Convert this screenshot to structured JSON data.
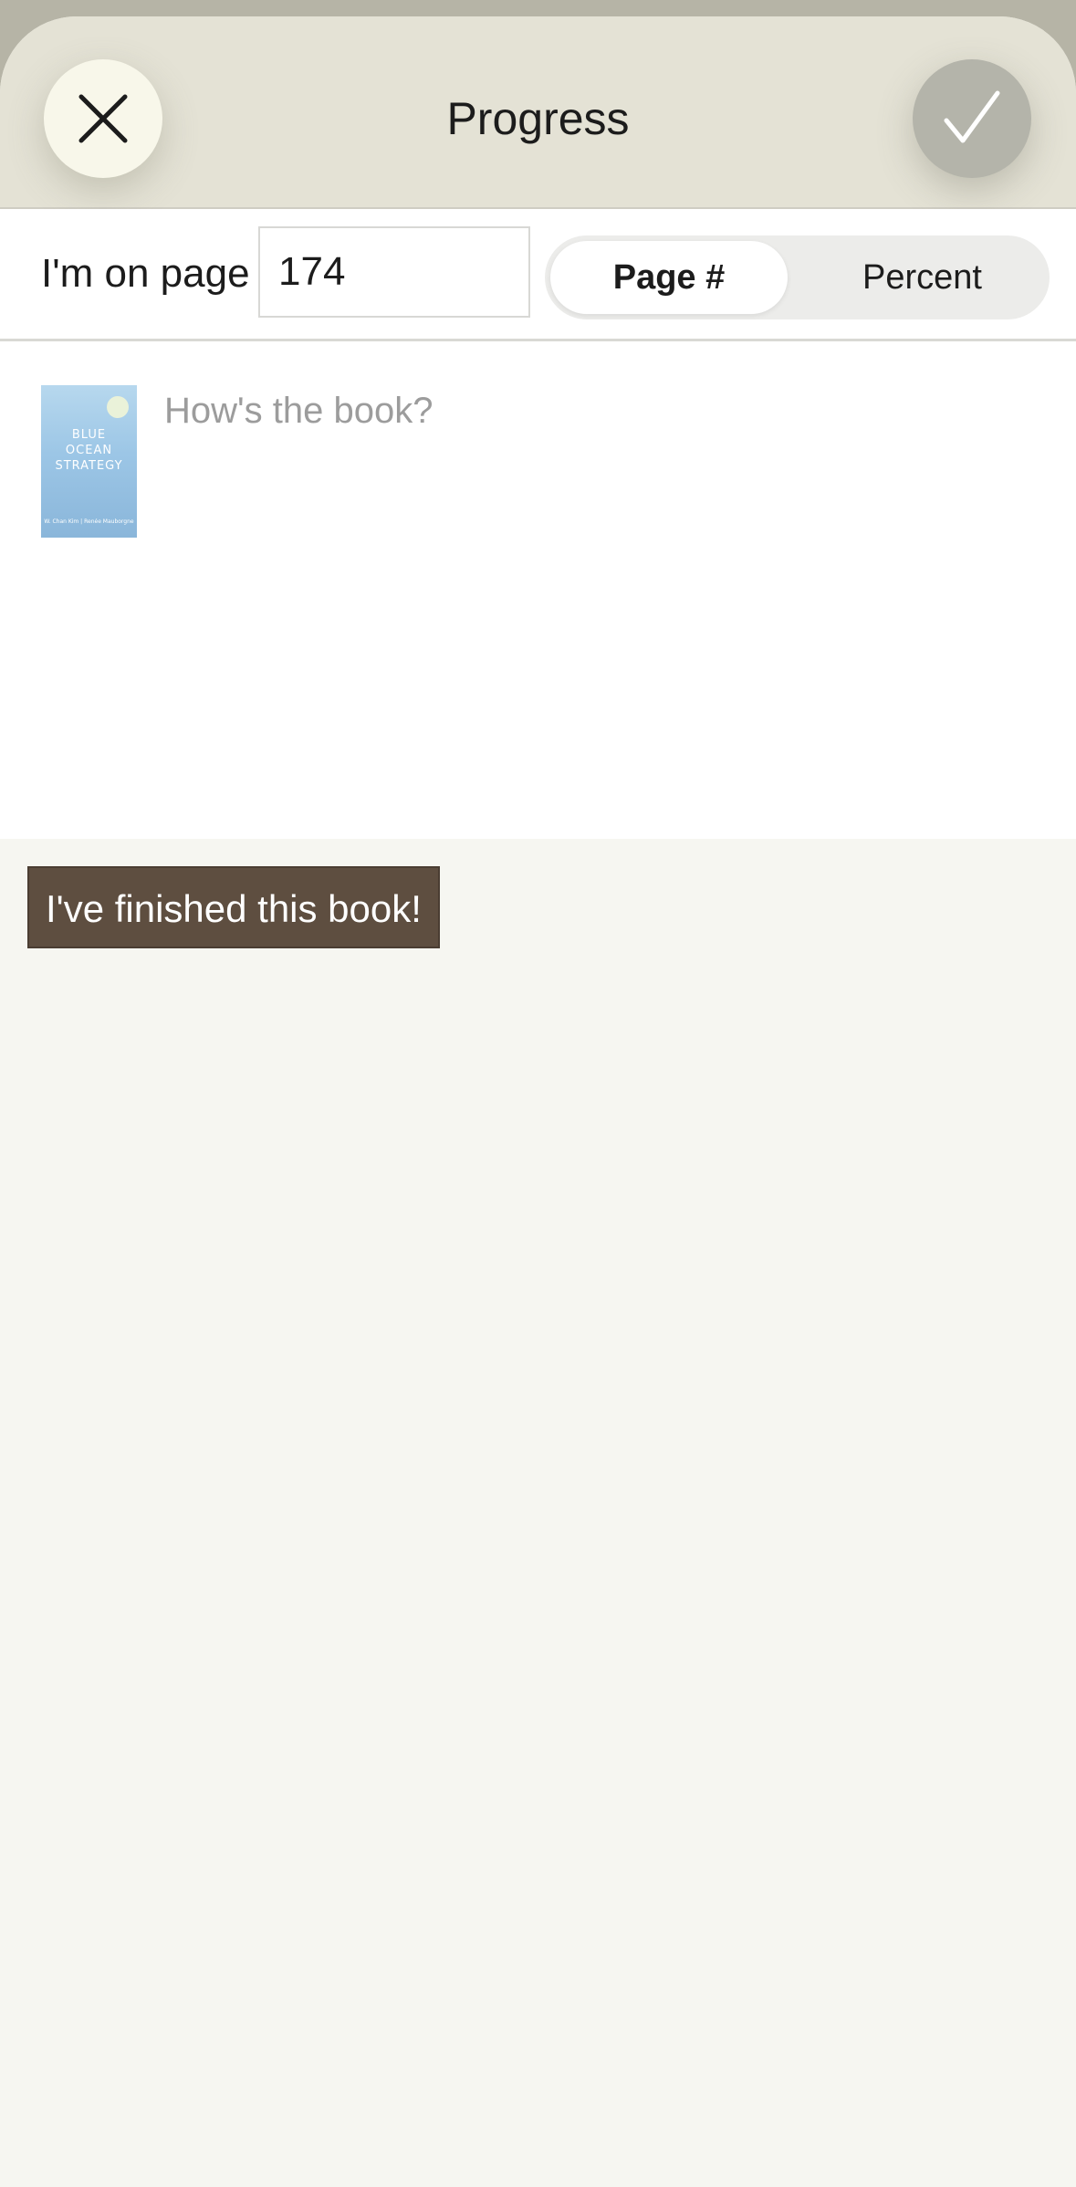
{
  "header": {
    "title": "Progress",
    "close_icon": "close-icon",
    "confirm_icon": "checkmark-icon"
  },
  "progress": {
    "label": "I'm on page",
    "value": "174",
    "modes": [
      "Page #",
      "Percent"
    ],
    "selected_mode": "Page #"
  },
  "review": {
    "placeholder": "How's the book?",
    "cover": {
      "title_lines": [
        "BLUE",
        "OCEAN",
        "STRATEGY"
      ],
      "author": "W. Chan Kim | Renée Mauborgne"
    }
  },
  "finish_button": {
    "label": "I've finished this book!"
  },
  "colors": {
    "header_bg": "#e4e2d5",
    "confirm_bg": "#b4b4aa",
    "finish_bg": "#5e4e40",
    "page_bg": "#f6f6f1"
  }
}
